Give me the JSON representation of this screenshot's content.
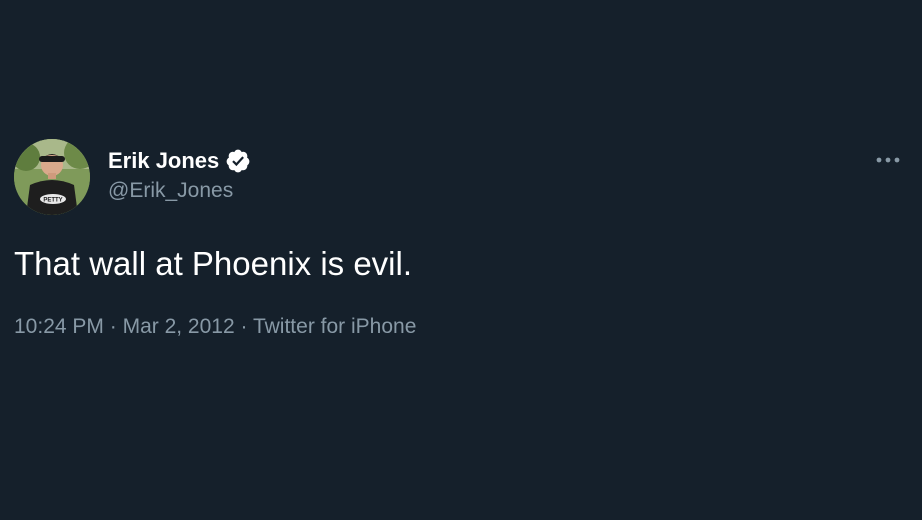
{
  "user": {
    "display_name": "Erik Jones",
    "handle": "@Erik_Jones",
    "verified": true,
    "verified_icon": "verified-badge-icon",
    "avatar_icon": "profile-photo"
  },
  "menu": {
    "icon": "more-options-icon"
  },
  "tweet": {
    "text": "That wall at Phoenix is evil.",
    "time": "10:24 PM",
    "separator": "·",
    "date": "Mar 2, 2012",
    "source": "Twitter for iPhone"
  },
  "colors": {
    "background": "#15202b",
    "primary_text": "#ffffff",
    "secondary_text": "#8899a6"
  }
}
